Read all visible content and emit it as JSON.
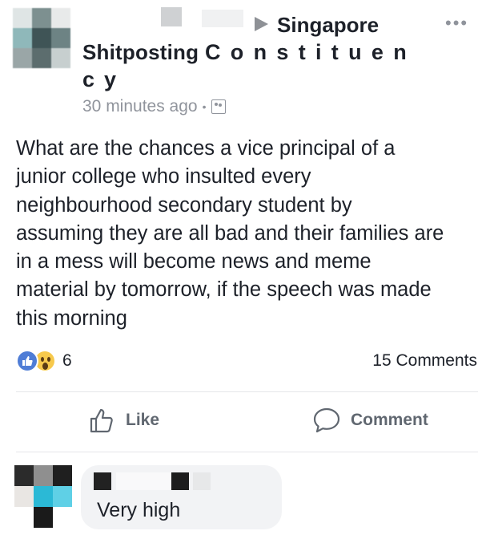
{
  "header": {
    "group_name": "Singapore",
    "author_part1": "Shitposting",
    "author_part2": "Constituen",
    "author_part3": "cy",
    "timestamp": "30 minutes ago",
    "separator": "•"
  },
  "post": {
    "lines": [
      "What are the chances a vice principal of a",
      "junior college who insulted every",
      "neighbourhood secondary student by",
      "assuming they are all bad and their families are",
      "in a mess will become news and meme",
      "material by tomorrow, if the speech was made",
      "this morning"
    ]
  },
  "stats": {
    "reaction_count": "6",
    "comments_count": "15 Comments"
  },
  "actions": {
    "like_label": "Like",
    "comment_label": "Comment"
  },
  "reply": {
    "text": "Very high"
  },
  "icons": {
    "more": "more-options-icon",
    "group": "group-icon",
    "like": "thumbs-up-icon",
    "comment": "comment-bubble-icon"
  },
  "colors": {
    "like_blue": "#4f7dd6",
    "wow_yellow": "#f7c94c",
    "muted": "#90949c"
  }
}
